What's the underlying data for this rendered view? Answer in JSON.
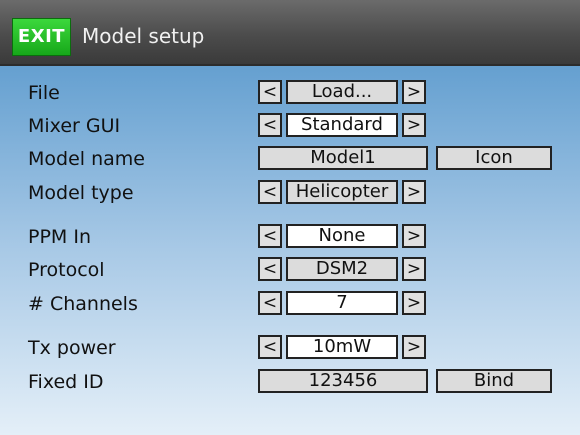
{
  "header": {
    "exit_label": "EXIT",
    "title": "Model setup"
  },
  "rows": {
    "file": {
      "label": "File",
      "value": "Load...",
      "prev": "<",
      "next": ">"
    },
    "mixer_gui": {
      "label": "Mixer GUI",
      "value": "Standard",
      "prev": "<",
      "next": ">"
    },
    "model_name": {
      "label": "Model name",
      "value": "Model1",
      "action": "Icon"
    },
    "model_type": {
      "label": "Model type",
      "value": "Helicopter",
      "prev": "<",
      "next": ">"
    },
    "ppm_in": {
      "label": "PPM In",
      "value": "None",
      "prev": "<",
      "next": ">"
    },
    "protocol": {
      "label": "Protocol",
      "value": "DSM2",
      "prev": "<",
      "next": ">"
    },
    "channels": {
      "label": "# Channels",
      "value": "7",
      "prev": "<",
      "next": ">"
    },
    "tx_power": {
      "label": "Tx power",
      "value": "10mW",
      "prev": "<",
      "next": ">"
    },
    "fixed_id": {
      "label": "Fixed ID",
      "value": "123456",
      "action": "Bind"
    }
  },
  "colors": {
    "exit_green": "#17a81a",
    "header_grey": "#4c4c4c",
    "background_top": "#4e90c5",
    "background_bottom": "#e4eff8",
    "field_grey": "#dcdcdc",
    "field_white": "#ffffff"
  }
}
